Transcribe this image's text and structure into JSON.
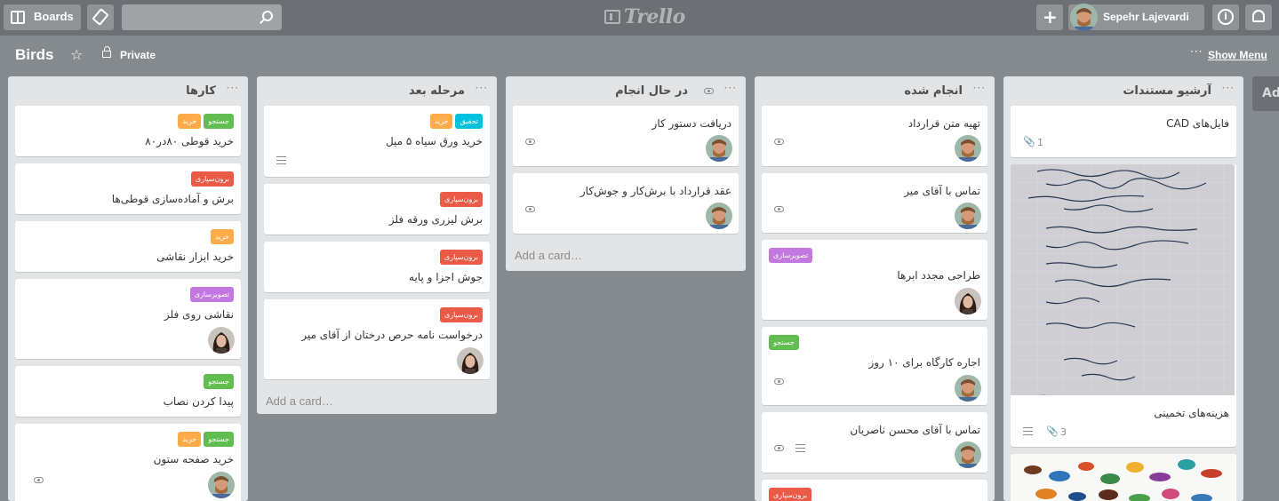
{
  "header": {
    "boards_label": "Boards",
    "logo_text": "Trello",
    "user_name": "Sepehr Lajevardi",
    "search_placeholder": ""
  },
  "board": {
    "title": "Birds",
    "visibility": "Private",
    "show_menu": "Show Menu",
    "add_list": "Add a list…"
  },
  "colors": {
    "header_bg": "#6c7075",
    "board_bg": "#858a8e",
    "list_bg": "#e2e4e6",
    "label_green": "#61bd4f",
    "label_orange": "#ffab4a",
    "label_red": "#eb5a46",
    "label_purple": "#c377e0",
    "label_teal": "#00c2e0"
  },
  "lists": [
    {
      "title": "کارها",
      "cards": [
        {
          "title": "خرید قوطی ۸۰در۸۰",
          "labels": [
            "جستجو",
            "خرید"
          ]
        },
        {
          "title": "برش و آماده‌سازی قوطی‌ها",
          "labels": [
            "برون‌سپاری"
          ]
        },
        {
          "title": "خرید ابزار نقاشی",
          "labels": [
            "خرید"
          ]
        },
        {
          "title": "نقاشی روی فلز",
          "labels": [
            "تصویرسازی"
          ],
          "member": "avatar-woman"
        },
        {
          "title": "پیدا کردن نصاب",
          "labels": [
            "جستجو"
          ]
        },
        {
          "title": "خرید صفحه ستون",
          "labels": [
            "جستجو",
            "خرید"
          ],
          "badges": [
            "eye-icon"
          ],
          "member": "avatar-man"
        }
      ]
    },
    {
      "title": "مرحله بعد",
      "cards": [
        {
          "title": "خرید ورق سیاه ۵ میل",
          "labels": [
            "تحقیق",
            "خرید"
          ],
          "badges": [
            "description-icon"
          ]
        },
        {
          "title": "برش لیزری ورقه فلز",
          "labels": [
            "برون‌سپاری"
          ]
        },
        {
          "title": "جوش اجزا و پایه",
          "labels": [
            "برون‌سپاری"
          ]
        },
        {
          "title": "درخواست نامه حرص درختان از آقای میر",
          "labels": [
            "برون‌سپاری"
          ],
          "member": "avatar-woman"
        }
      ],
      "add_card": "Add a card…"
    },
    {
      "title": "در حال انجام",
      "cards": [
        {
          "title": "دریافت دستور کار",
          "badges": [
            "eye-icon"
          ],
          "member": "avatar-man"
        },
        {
          "title": "عقد قرارداد با برش‌کار و جوش‌کار",
          "badges": [
            "eye-icon"
          ],
          "member": "avatar-man"
        }
      ],
      "add_card": "Add a card…"
    },
    {
      "title": "انجام شده",
      "cards": [
        {
          "title": "تهیه متن قرارداد",
          "badges": [
            "eye-icon"
          ],
          "member": "avatar-man"
        },
        {
          "title": "تماس با آقای میر",
          "badges": [
            "eye-icon"
          ],
          "member": "avatar-man"
        },
        {
          "title": "طراحی مجدد ابرها",
          "labels": [
            "تصویرسازی"
          ],
          "member": "avatar-woman"
        },
        {
          "title": "اجاره کارگاه برای ۱۰ روز",
          "labels": [
            "جستجو"
          ],
          "badges": [
            "eye-icon"
          ],
          "member": "avatar-man"
        },
        {
          "title": "تماس با آقای محسن ناصریان",
          "badges": [
            "eye-icon",
            "description-icon"
          ],
          "member": "avatar-man"
        },
        {
          "title": "",
          "labels": [
            "برون‌سپاری"
          ]
        }
      ]
    },
    {
      "title": "آرشیو مستندات",
      "cards": [
        {
          "title": "فایل‌های CAD",
          "attachments": "1"
        },
        {
          "title": "هزینه‌های تخمینی",
          "cover": "handwritten-notes-photo",
          "badges": [
            "description-icon"
          ],
          "attachments": "3"
        },
        {
          "title": "",
          "cover": "birds-illustration"
        }
      ]
    }
  ]
}
